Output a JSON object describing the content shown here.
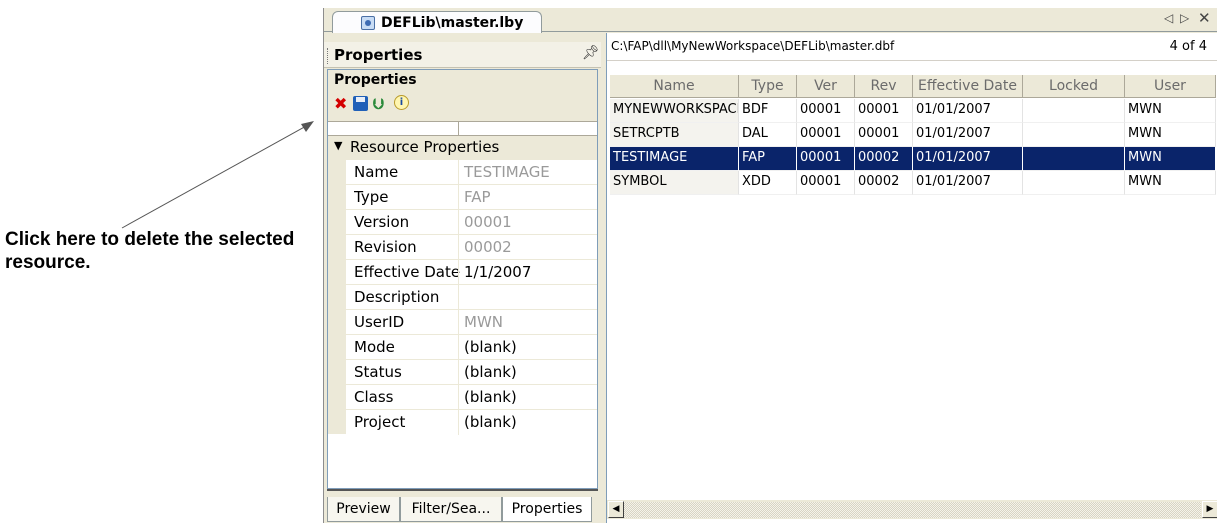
{
  "annotation": {
    "text": "Click here to delete the selected resource."
  },
  "window": {
    "tab_title": "DEFLib\\master.lby",
    "nav_left": "◁",
    "nav_right": "▷",
    "close": "✕"
  },
  "properties_panel": {
    "header_title": "Properties",
    "pin_icon": "pin-icon",
    "sub_title": "Properties",
    "toolbar": [
      "delete-icon",
      "save-icon",
      "check-in-icon",
      "info-icon"
    ],
    "section_label": "Resource Properties",
    "rows": [
      {
        "name": "Name",
        "value": "TESTIMAGE",
        "readonly": true
      },
      {
        "name": "Type",
        "value": "FAP",
        "readonly": true
      },
      {
        "name": "Version",
        "value": "00001",
        "readonly": true
      },
      {
        "name": "Revision",
        "value": "00002",
        "readonly": true
      },
      {
        "name": "Effective Date",
        "value": "1/1/2007",
        "readonly": false
      },
      {
        "name": "Description",
        "value": "",
        "readonly": false
      },
      {
        "name": "UserID",
        "value": "MWN",
        "readonly": true
      },
      {
        "name": "Mode",
        "value": "(blank)",
        "readonly": false
      },
      {
        "name": "Status",
        "value": "(blank)",
        "readonly": false
      },
      {
        "name": "Class",
        "value": "(blank)",
        "readonly": false
      },
      {
        "name": "Project",
        "value": "(blank)",
        "readonly": false
      }
    ],
    "bottom_tabs": [
      "Preview",
      "Filter/Sea...",
      "Properties"
    ]
  },
  "list_panel": {
    "path": "C:\\FAP\\dll\\MyNewWorkspace\\DEFLib\\master.dbf",
    "count": "4 of 4",
    "columns": [
      "Name",
      "Type",
      "Ver",
      "Rev",
      "Effective Date",
      "Locked",
      "User"
    ],
    "rows": [
      {
        "Name": "MYNEWWORKSPACE",
        "Type": "BDF",
        "Ver": "00001",
        "Rev": "00001",
        "Effective Date": "01/01/2007",
        "Locked": "",
        "User": "MWN",
        "selected": false
      },
      {
        "Name": "SETRCPTB",
        "Type": "DAL",
        "Ver": "00001",
        "Rev": "00001",
        "Effective Date": "01/01/2007",
        "Locked": "",
        "User": "MWN",
        "selected": false
      },
      {
        "Name": "TESTIMAGE",
        "Type": "FAP",
        "Ver": "00001",
        "Rev": "00002",
        "Effective Date": "01/01/2007",
        "Locked": "",
        "User": "MWN",
        "selected": true
      },
      {
        "Name": "SYMBOL",
        "Type": "XDD",
        "Ver": "00001",
        "Rev": "00002",
        "Effective Date": "01/01/2007",
        "Locked": "",
        "User": "MWN",
        "selected": false
      }
    ]
  }
}
